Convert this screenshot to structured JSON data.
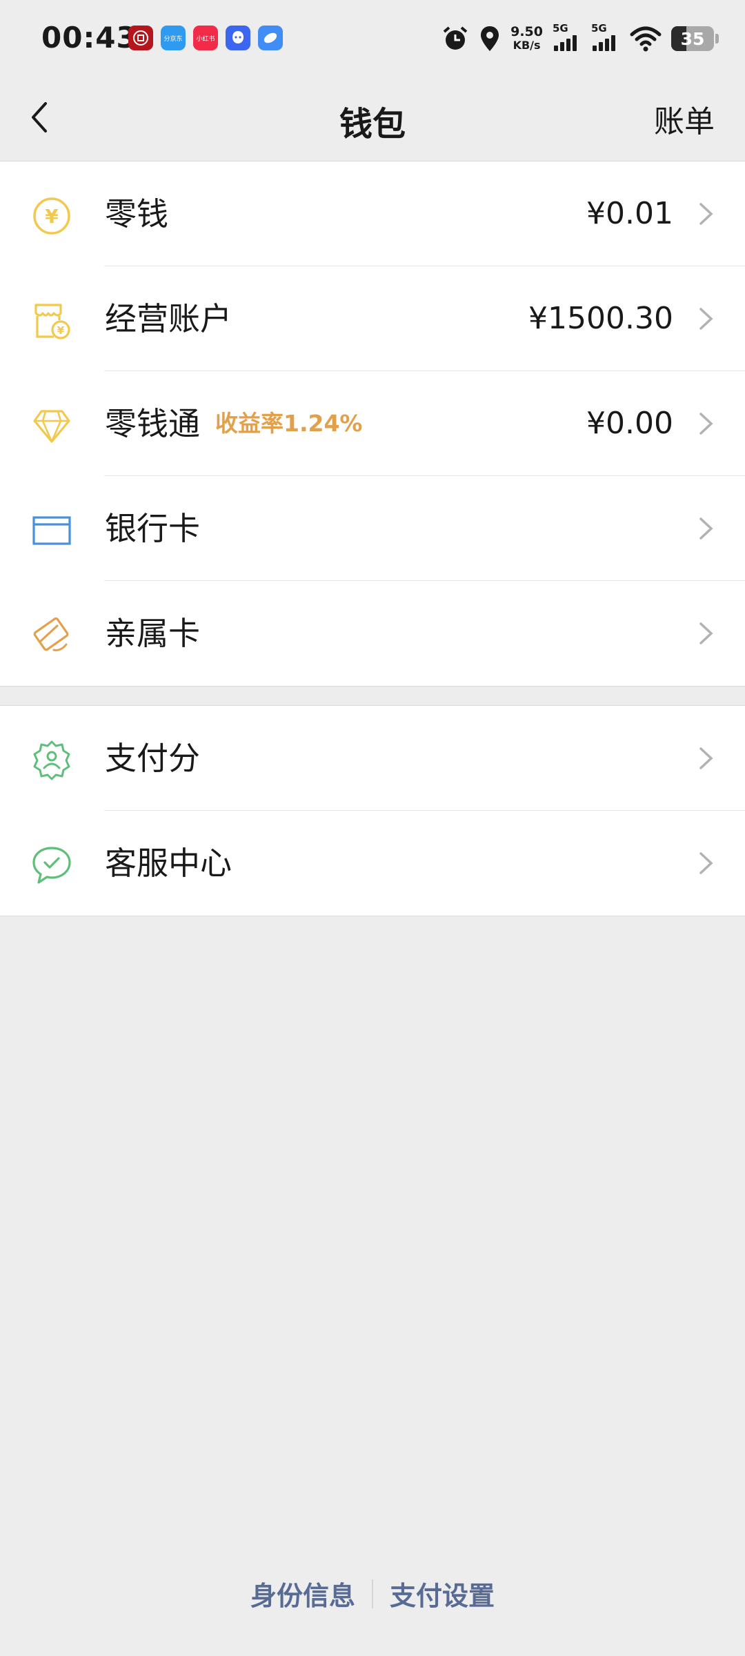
{
  "status_bar": {
    "time": "00:43",
    "app_icons": [
      {
        "name": "bank-app-icon",
        "text": "",
        "color": "#b3161c"
      },
      {
        "name": "jd-app-icon",
        "text": "分京东",
        "color": "#2e9bf0"
      },
      {
        "name": "xiaohongshu-app-icon",
        "text": "小红书",
        "color": "#f22b49"
      },
      {
        "name": "qq-app-icon",
        "text": "",
        "color": "#3c66f0"
      },
      {
        "name": "browser-app-icon",
        "text": "",
        "color": "#3f8df5"
      }
    ],
    "net_speed_value": "9.50",
    "net_speed_unit": "KB/s",
    "sim1": "5G",
    "sim2": "5G",
    "battery": "35",
    "battery_level": 0.35
  },
  "nav": {
    "title": "钱包",
    "right_action": "账单"
  },
  "group1": [
    {
      "id": "change",
      "label": "零钱",
      "value": "¥0.01",
      "icon": "yen-coin-icon",
      "color": "#f2c94c"
    },
    {
      "id": "business",
      "label": "经营账户",
      "value": "¥1500.30",
      "icon": "shop-icon",
      "color": "#f2c94c"
    },
    {
      "id": "lqt",
      "label": "零钱通",
      "tag": "收益率1.24%",
      "value": "¥0.00",
      "icon": "diamond-icon",
      "color": "#f2c94c"
    },
    {
      "id": "bankcard",
      "label": "银行卡",
      "icon": "card-icon",
      "color": "#4a90d9"
    },
    {
      "id": "family",
      "label": "亲属卡",
      "icon": "family-card-icon",
      "color": "#e3a04a"
    }
  ],
  "group2": [
    {
      "id": "payscore",
      "label": "支付分",
      "icon": "badge-user-icon",
      "color": "#5fbf7a"
    },
    {
      "id": "service",
      "label": "客服中心",
      "icon": "chat-check-icon",
      "color": "#5fbf7a"
    }
  ],
  "footer": {
    "identity": "身份信息",
    "settings": "支付设置"
  },
  "colors": {
    "background": "#ededed",
    "link": "#576b95",
    "tag": "#e3a04a"
  }
}
